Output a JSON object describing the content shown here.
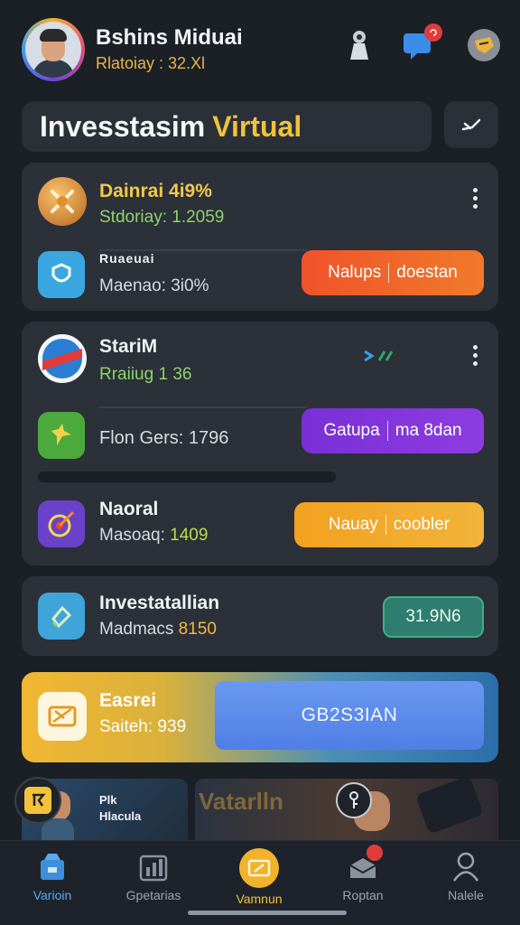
{
  "header": {
    "user_name": "Bshins Miduai",
    "user_sub": "Rlatoiay : 32.Xl",
    "notification_badge": ""
  },
  "title": {
    "part1": "Invesstasim",
    "part2": "Virtual"
  },
  "card1": {
    "row1": {
      "title": "Dainrai 4i9%",
      "sub": "Stdoriay: 1.2059"
    },
    "row2": {
      "title": "Ruaeuai",
      "sub": "Maenao: 3i0%",
      "action_left": "Nalups",
      "action_right": "doestan"
    }
  },
  "card2": {
    "row1": {
      "title": "StariM",
      "sub": "Rraiiug 1 36"
    },
    "row2": {
      "sub": "Flon Gers: 1796",
      "action_left": "Gatupa",
      "action_right": "ma 8dan"
    },
    "row3": {
      "title": "Naoral",
      "sub_label": "Masoaq:",
      "sub_value": "1409",
      "action_left": "Nauay",
      "action_right": "coobler"
    }
  },
  "card3": {
    "title": "Investatallian",
    "sub_label": "Madmacs",
    "sub_value": "8150",
    "value_badge": "31.9N6"
  },
  "feature": {
    "title": "Easrei",
    "sub": "Saiteh: 939",
    "button": "GB2S3IAN"
  },
  "thumbs": {
    "left_title": "Plk",
    "left_sub": "Hlacula",
    "right_title": "Vatarlln"
  },
  "bottom_nav": [
    {
      "label": "Varioin",
      "icon": "shop-icon",
      "active": true
    },
    {
      "label": "Gpetarias",
      "icon": "chart-icon",
      "active": false
    },
    {
      "label": "Vamnun",
      "icon": "ticket-icon",
      "active": false
    },
    {
      "label": "Roptan",
      "icon": "mail-icon",
      "active": false
    },
    {
      "label": "Nalele",
      "icon": "profile-icon",
      "active": false
    }
  ],
  "colors": {
    "orange_action": "#ef5a2a",
    "purple_action": "#7b33d6",
    "yellow_action": "#f2a526",
    "green_value": "#2e8a76",
    "accent_yellow": "#f0c23b"
  }
}
